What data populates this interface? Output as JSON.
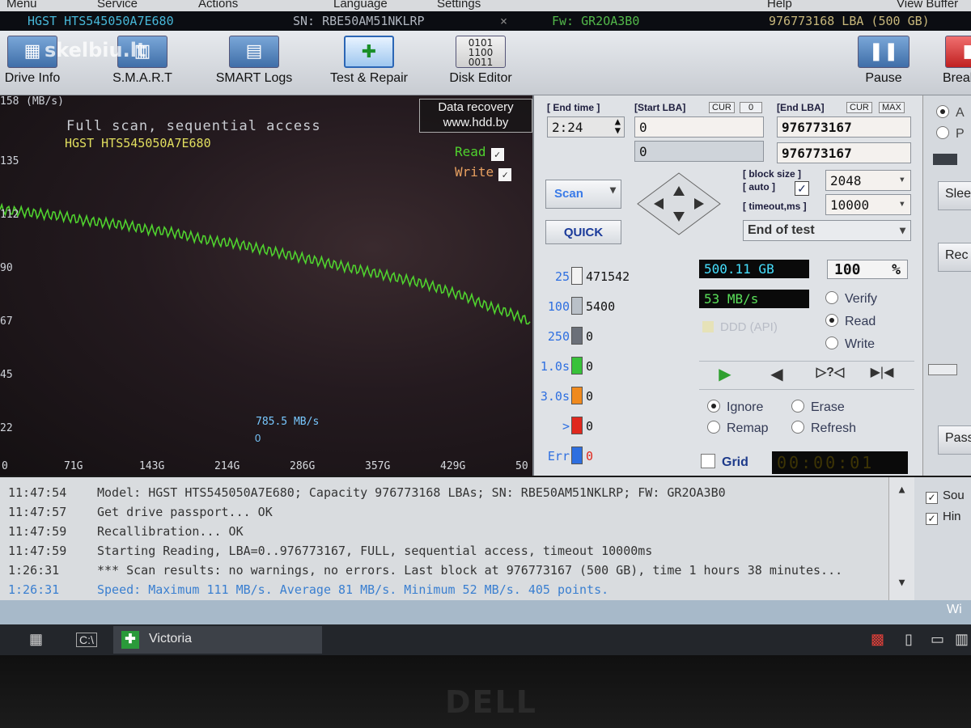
{
  "menu": {
    "items": [
      "Menu",
      "Service",
      "Actions",
      "Language",
      "Settings",
      "Help",
      "View Buffer"
    ]
  },
  "drive_bar": {
    "model": "HGST HTS545050A7E680",
    "serial": "SN: RBE50AM51NKLRP",
    "close": "×",
    "firmware": "Fw: GR2OA3B0",
    "lba": "976773168 LBA (500 GB)"
  },
  "toolbar": {
    "watermark": "skelbiu.lt",
    "buttons": [
      {
        "label": "Drive Info",
        "icon": "drive-info-icon"
      },
      {
        "label": "S.M.A.R.T",
        "icon": "smart-icon"
      },
      {
        "label": "SMART Logs",
        "icon": "smart-logs-icon"
      },
      {
        "label": "Test & Repair",
        "icon": "test-repair-icon"
      },
      {
        "label": "Disk Editor",
        "icon": "disk-editor-icon"
      }
    ],
    "pause": "Pause",
    "break": "Break"
  },
  "graph": {
    "y_unit": "(MB/s)",
    "title": "Full scan, sequential access",
    "subtitle": "HGST HTS545050A7E680",
    "brand_line1": "Data recovery",
    "brand_line2": "www.hdd.by",
    "legend_read": "Read",
    "legend_write": "Write",
    "current_speed": "785.5 MB/s",
    "current_zero": "0",
    "line_color": "#4fd22e"
  },
  "chart_data": {
    "type": "line",
    "title": "Full scan, sequential access",
    "subtitle": "HGST HTS545050A7E680",
    "ylabel": "(MB/s)",
    "y_ticks": [
      "158",
      "135",
      "112",
      "90",
      "67",
      "45",
      "22",
      "0"
    ],
    "x_ticks": [
      "0",
      "71G",
      "143G",
      "214G",
      "286G",
      "357G",
      "429G",
      "50"
    ],
    "xlim": [
      0,
      500
    ],
    "ylim": [
      0,
      158
    ],
    "grid": false,
    "series": [
      {
        "name": "Read",
        "x": [
          0,
          20,
          40,
          60,
          80,
          100,
          120,
          140,
          160,
          180,
          200,
          220,
          240,
          260,
          280,
          300,
          320,
          340,
          360,
          380,
          400,
          420,
          440,
          460,
          480,
          500
        ],
        "y": [
          110,
          109,
          108,
          107,
          105,
          104,
          103,
          101,
          100,
          98,
          96,
          95,
          93,
          91,
          89,
          87,
          85,
          83,
          81,
          79,
          77,
          74,
          71,
          67,
          64,
          60
        ]
      }
    ]
  },
  "controls": {
    "end_time_label": "[ End time ]",
    "end_time": "2:24",
    "start_lba_label": "[Start LBA]",
    "cur": "CUR",
    "cur_value": "0",
    "end_lba_label": "[End LBA]",
    "max": "MAX",
    "start_lba": "0",
    "start_lba2": "0",
    "end_lba": "976773167",
    "end_lba2": "976773167",
    "block_size_label": "[ block size ]",
    "auto_label": "[ auto ]",
    "block_size": "2048",
    "timeout_label": "[ timeout,ms ]",
    "timeout": "10000",
    "scan_button": "Scan",
    "quick_button": "QUICK",
    "end_action": "End of test",
    "size_read": "500.11 GB",
    "percent": "100",
    "percent_sign": "%",
    "speed": "53 MB/s",
    "ddd": "DDD (API)",
    "mode_verify": "Verify",
    "mode_read": "Read",
    "mode_write": "Write",
    "ignore": "Ignore",
    "erase": "Erase",
    "remap": "Remap",
    "refresh": "Refresh",
    "grid": "Grid",
    "timer": "00:00:01"
  },
  "blocks": [
    {
      "key": "25",
      "value": "471542",
      "color": "#f2f2f2"
    },
    {
      "key": "100",
      "value": "5400",
      "color": "#b9c0c8"
    },
    {
      "key": "250",
      "value": "0",
      "color": "#6b7079"
    },
    {
      "key": "1.0s",
      "value": "0",
      "color": "#38c23a"
    },
    {
      "key": "3.0s",
      "value": "0",
      "color": "#f08a1e"
    },
    {
      "key": ">",
      "value": "0",
      "color": "#e0281e"
    },
    {
      "key": "Err",
      "value": "0",
      "color": "#2e6fe0"
    }
  ],
  "right_strip": {
    "opt1": "A",
    "opt2": "P",
    "sleep": "Slee",
    "rec": "Rec",
    "pass": "Pass"
  },
  "log": [
    {
      "time": "11:47:54",
      "text": "Model: HGST HTS545050A7E680; Capacity 976773168 LBAs; SN: RBE50AM51NKLRP; FW: GR2OA3B0"
    },
    {
      "time": "11:47:57",
      "text": "Get drive passport... OK"
    },
    {
      "time": "11:47:59",
      "text": "Recallibration... OK"
    },
    {
      "time": "11:47:59",
      "text": "Starting Reading, LBA=0..976773167, FULL, sequential access, timeout 10000ms"
    },
    {
      "time": "1:26:31",
      "text": "*** Scan results: no warnings, no errors. Last block at 976773167 (500 GB), time 1 hours 38 minutes..."
    },
    {
      "time": "1:26:31",
      "text": "Speed: Maximum 111 MB/s. Average 81 MB/s. Minimum 52 MB/s. 405 points."
    }
  ],
  "log_right": {
    "sound": "Sou",
    "hints": "Hin"
  },
  "taskbar": {
    "app": "Victoria",
    "win": "Wi"
  },
  "laptop": {
    "brand": "DELL"
  }
}
